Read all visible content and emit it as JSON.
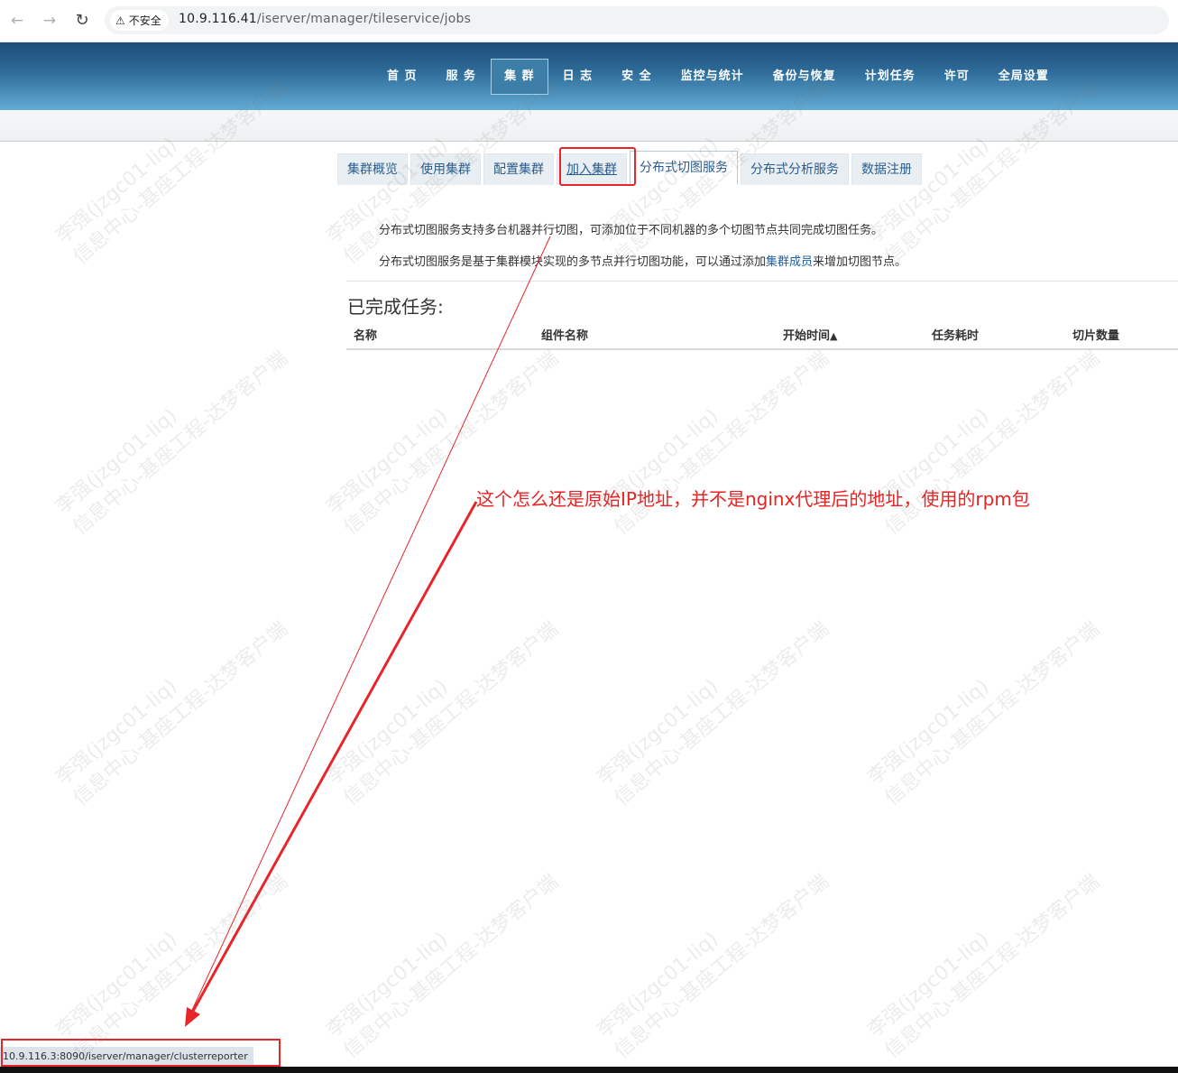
{
  "browser": {
    "back_icon": "arrow-left-icon",
    "forward_icon": "arrow-right-icon",
    "reload_icon": "reload-icon",
    "security_label": "不安全",
    "url_host": "10.9.116.41",
    "url_path": "/iserver/manager/tileservice/jobs"
  },
  "header": {
    "nav": [
      {
        "label": "首 页"
      },
      {
        "label": "服 务"
      },
      {
        "label": "集 群",
        "active": true
      },
      {
        "label": "日 志"
      },
      {
        "label": "安 全"
      },
      {
        "label": "监控与统计"
      },
      {
        "label": "备份与恢复"
      },
      {
        "label": "计划任务"
      },
      {
        "label": "许可"
      },
      {
        "label": "全局设置"
      }
    ]
  },
  "sub_tabs": [
    {
      "label": "集群概览"
    },
    {
      "label": "使用集群"
    },
    {
      "label": "配置集群"
    },
    {
      "label": "加入集群",
      "highlighted": true
    },
    {
      "label": "分布式切图服务",
      "active": true
    },
    {
      "label": "分布式分析服务"
    },
    {
      "label": "数据注册"
    }
  ],
  "content": {
    "desc1": "分布式切图服务支持多台机器并行切图，可添加位于不同机器的多个切图节点共同完成切图任务。",
    "desc2_prefix": "分布式切图服务是基于集群模块实现的多节点并行切图功能，可以通过添加",
    "desc2_link": "集群成员",
    "desc2_suffix": "来增加切图节点。",
    "section_title": "已完成任务:",
    "table_columns": [
      "名称",
      "组件名称",
      "开始时间",
      "任务耗时",
      "切片数量"
    ],
    "sort_icon": "caret-up-icon"
  },
  "annotation": {
    "text": "这个怎么还是原始IP地址，并不是nginx代理后的地址，使用的rpm包",
    "color": "#e82323"
  },
  "status_bar": {
    "url": "10.9.116.3:8090/iserver/manager/clusterreporter"
  },
  "watermark": {
    "line1": "李强(jzgc01-liq)",
    "line2": "信息中心-基座工程-达梦客户端"
  }
}
